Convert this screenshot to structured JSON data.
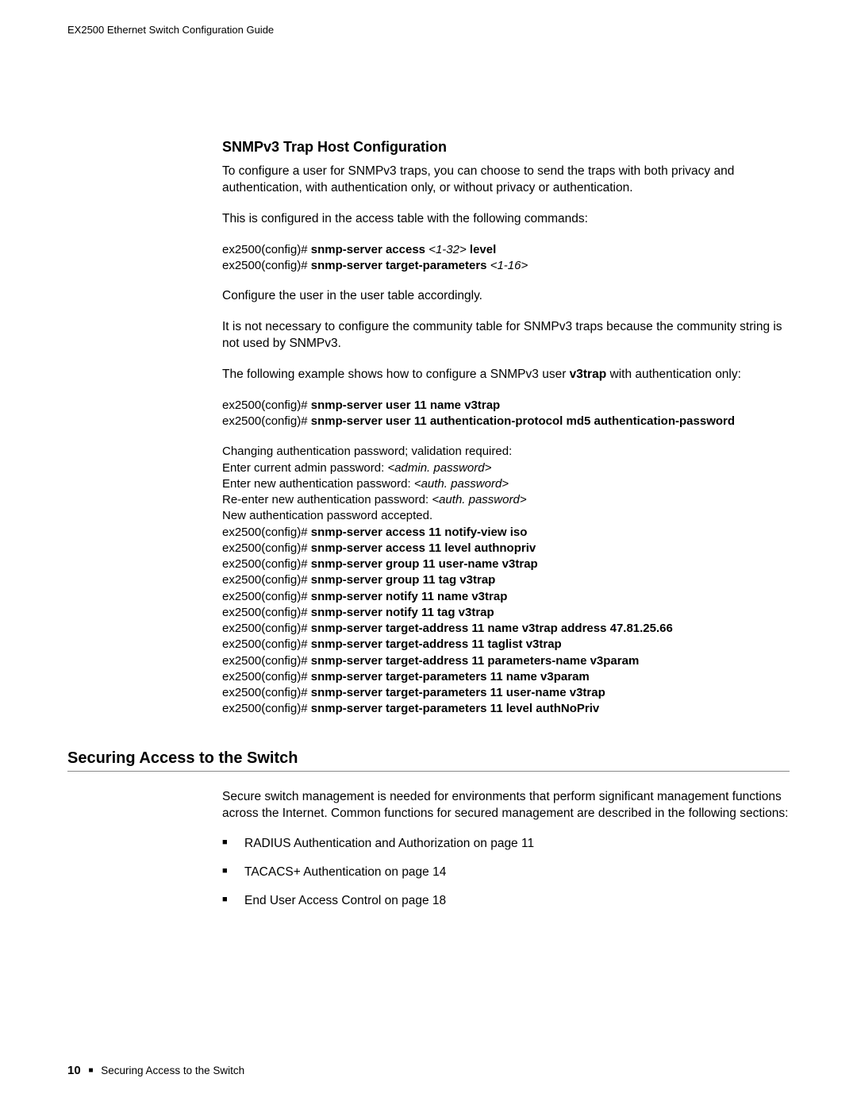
{
  "header": {
    "running_title": "EX2500 Ethernet Switch Configuration Guide"
  },
  "section1": {
    "heading": "SNMPv3 Trap Host Configuration",
    "p1": "To configure a user for SNMPv3 traps, you can choose to send the traps with both privacy and authentication, with authentication only, or without privacy or authentication.",
    "p2": "This is configured in the access table with the following commands:",
    "cmd1_prompt": "ex2500(config)# ",
    "cmd1_bold": "snmp-server access ",
    "cmd1_ital": "<1-32>",
    "cmd1_bold2": " level",
    "cmd2_prompt": "ex2500(config)# ",
    "cmd2_bold": "snmp-server target-parameters ",
    "cmd2_ital": "<1-16>",
    "p3": "Configure the user in the user table accordingly.",
    "p4": "It is not necessary to configure the community table for SNMPv3 traps because the community string is not used by SNMPv3.",
    "p5_a": "The following example shows how to configure a SNMPv3 user ",
    "p5_b": "v3trap",
    "p5_c": " with authentication only:",
    "cmd3_prompt": "ex2500(config)# ",
    "cmd3_bold": "snmp-server user 11 name v3trap",
    "cmd4_prompt": "ex2500(config)# ",
    "cmd4_bold": "snmp-server user 11 authentication-protocol md5 authentication-password",
    "out1": "Changing authentication password; validation required:",
    "out2a": "Enter current admin password: ",
    "out2b": "<admin. password>",
    "out3a": "Enter new authentication password: ",
    "out3b": "<auth. password>",
    "out4a": "Re-enter new authentication password: ",
    "out4b": "<auth. password>",
    "out5": "New authentication password accepted.",
    "c5p": "ex2500(config)# ",
    "c5b": "snmp-server access 11 notify-view iso",
    "c6p": "ex2500(config)# ",
    "c6b": "snmp-server access 11 level authnopriv",
    "c7p": "ex2500(config)# ",
    "c7b": "snmp-server group 11 user-name v3trap",
    "c8p": "ex2500(config)# ",
    "c8b": "snmp-server group 11 tag v3trap",
    "c9p": "ex2500(config)# ",
    "c9b": "snmp-server notify 11 name v3trap",
    "c10p": "ex2500(config)# ",
    "c10b": "snmp-server notify 11 tag v3trap",
    "c11p": "ex2500(config)# ",
    "c11b": "snmp-server target-address 11 name v3trap address 47.81.25.66",
    "c12p": "ex2500(config)# ",
    "c12b": "snmp-server target-address 11 taglist v3trap",
    "c13p": "ex2500(config)# ",
    "c13b": "snmp-server target-address 11 parameters-name v3param",
    "c14p": "ex2500(config)# ",
    "c14b": "snmp-server target-parameters 11 name v3param",
    "c15p": "ex2500(config)# ",
    "c15b": "snmp-server target-parameters 11 user-name v3trap",
    "c16p": "ex2500(config)# ",
    "c16b": "snmp-server target-parameters 11 level authNoPriv"
  },
  "section2": {
    "heading": "Securing Access to the Switch",
    "p1": "Secure switch management is needed for environments that perform significant management functions across the Internet. Common functions for secured management are described in the following sections:",
    "bullets": {
      "b1": "RADIUS Authentication and Authorization on page 11",
      "b2": "TACACS+ Authentication on page 14",
      "b3": "End User Access Control on page 18"
    }
  },
  "footer": {
    "page_num": "10",
    "section_title": "Securing Access to the Switch"
  }
}
